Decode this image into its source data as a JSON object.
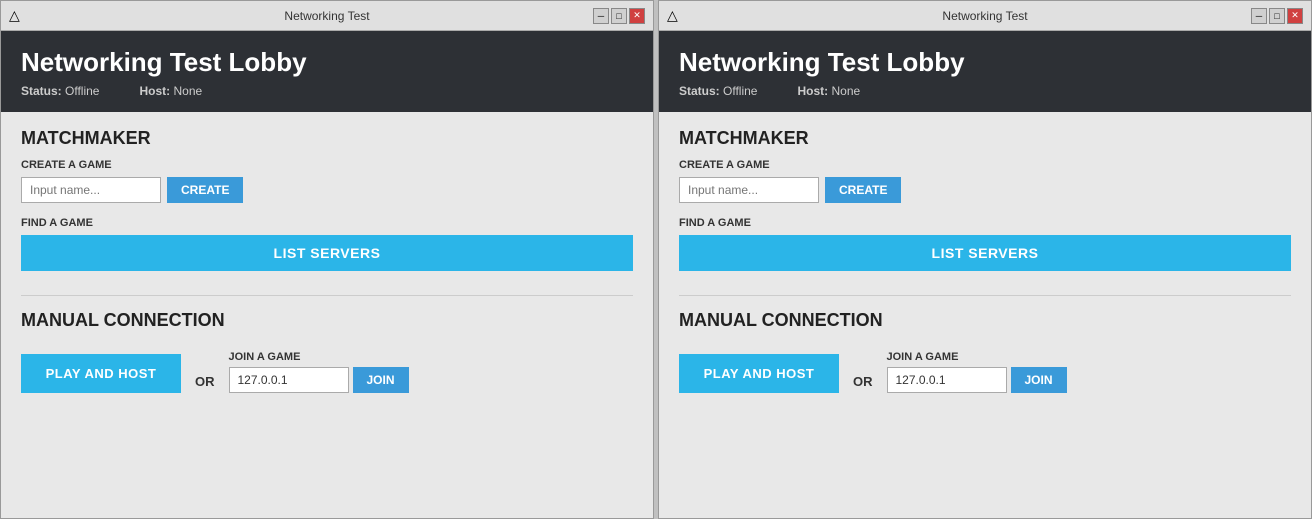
{
  "windows": [
    {
      "id": "window-1",
      "titlebar": {
        "title": "Networking Test",
        "minimize_label": "─",
        "maximize_label": "□",
        "close_label": "✕"
      },
      "header": {
        "title": "Networking Test Lobby",
        "status_label": "Status:",
        "status_value": "Offline",
        "host_label": "Host:",
        "host_value": "None"
      },
      "matchmaker": {
        "section_title": "MATCHMAKER",
        "create_label": "CREATE A GAME",
        "input_placeholder": "Input name...",
        "create_button": "CREATE",
        "find_label": "FIND A GAME",
        "list_servers_button": "LIST SERVERS"
      },
      "manual": {
        "section_title": "MANUAL CONNECTION",
        "play_host_button": "PLAY AND HOST",
        "or_text": "OR",
        "join_label": "JOIN A GAME",
        "ip_value": "127.0.0.1",
        "join_button": "JOIN"
      }
    },
    {
      "id": "window-2",
      "titlebar": {
        "title": "Networking Test",
        "minimize_label": "─",
        "maximize_label": "□",
        "close_label": "✕"
      },
      "header": {
        "title": "Networking Test Lobby",
        "status_label": "Status:",
        "status_value": "Offline",
        "host_label": "Host:",
        "host_value": "None"
      },
      "matchmaker": {
        "section_title": "MATCHMAKER",
        "create_label": "CREATE A GAME",
        "input_placeholder": "Input name...",
        "create_button": "CREATE",
        "find_label": "FIND A GAME",
        "list_servers_button": "LIST SERVERS"
      },
      "manual": {
        "section_title": "MANUAL CONNECTION",
        "play_host_button": "PLAY AND HOST",
        "or_text": "OR",
        "join_label": "JOIN A GAME",
        "ip_value": "127.0.0.1",
        "join_button": "JOIN"
      }
    }
  ]
}
